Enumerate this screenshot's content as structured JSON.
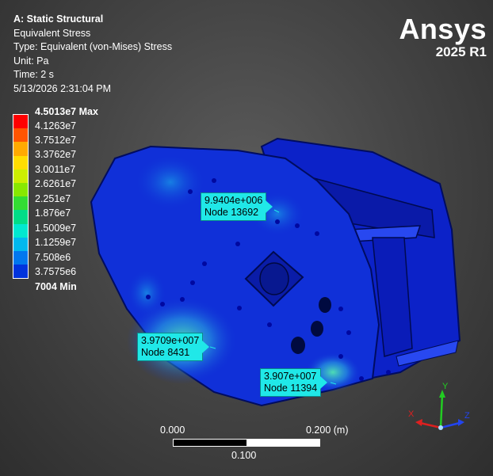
{
  "info": {
    "title": "A: Static Structural",
    "result": "Equivalent Stress",
    "type": "Type: Equivalent (von-Mises) Stress",
    "unit": "Unit: Pa",
    "time": "Time: 2 s",
    "timestamp": "5/13/2026 2:31:04 PM"
  },
  "logo": {
    "brand": "Ansys",
    "version": "2025 R1"
  },
  "legend": {
    "labels": [
      "4.5013e7 Max",
      "4.1263e7",
      "3.7512e7",
      "3.3762e7",
      "3.0011e7",
      "2.6261e7",
      "2.251e7",
      "1.876e7",
      "1.5009e7",
      "1.1259e7",
      "7.508e6",
      "3.7575e6",
      "7004 Min"
    ],
    "colors": [
      "#ff0000",
      "#ff5500",
      "#ffaa00",
      "#ffdd00",
      "#ccee00",
      "#88e800",
      "#33dd33",
      "#00dd88",
      "#00e8d0",
      "#00b8ee",
      "#0077ee",
      "#0033dd"
    ]
  },
  "probes": [
    {
      "value": "9.9404e+006",
      "node": "Node 13692"
    },
    {
      "value": "3.9709e+007",
      "node": "Node 8431"
    },
    {
      "value": "3.907e+007",
      "node": "Node 11394"
    }
  ],
  "scale": {
    "left": "0.000",
    "right": "0.200 (m)",
    "mid": "0.100"
  },
  "triad": {
    "x": "X",
    "y": "Y",
    "z": "Z"
  }
}
